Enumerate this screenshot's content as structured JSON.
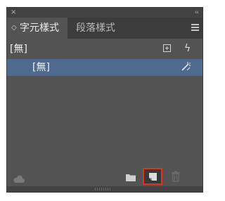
{
  "window": {
    "close_glyph": "×",
    "collapse_glyph": "‹‹"
  },
  "tabs": [
    {
      "label": "字元樣式",
      "active": true,
      "chevron": "◇"
    },
    {
      "label": "段落樣式",
      "active": false
    }
  ],
  "styles": [
    {
      "label": "[無]",
      "selected": false
    },
    {
      "label": "[無]",
      "selected": true
    }
  ],
  "icons": {
    "menu": "hamburger-menu-icon",
    "add": "add-style-override-icon",
    "lightning": "lightning-bolt-icon",
    "wand": "clear-override-wand-icon",
    "cloud": "creative-cloud-library-icon",
    "folder": "new-style-group-folder-icon",
    "new_style": "create-new-style-icon",
    "trash": "delete-trash-icon",
    "bolt_glyph": "ϟ"
  },
  "colors": {
    "panel_bg": "#535353",
    "tab_bar_bg": "#3c3c3c",
    "selected_row": "#4f6a8f",
    "highlight_border": "#e0321f"
  }
}
